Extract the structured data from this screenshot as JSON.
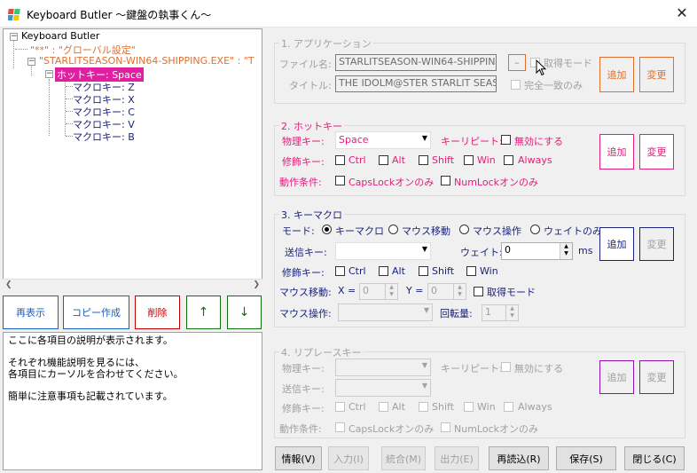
{
  "window": {
    "title": "Keyboard Butler 〜鍵盤の執事くん〜",
    "close": "✕"
  },
  "tree": {
    "root": "Keyboard Butler",
    "global": "\"**\" : \"グローバル設定\"",
    "app": "\"STARLITSEASON-WIN64-SHIPPING.EXE\" : \"T",
    "hotkey": "ホットキー: Space",
    "macros": [
      "マクロキー: Z",
      "マクロキー: X",
      "マクロキー: C",
      "マクロキー: V",
      "マクロキー: B"
    ]
  },
  "tree_buttons": {
    "refresh": "再表示",
    "copy": "コピー作成",
    "delete": "削除",
    "up": "↑",
    "down": "↓"
  },
  "description": {
    "line1": "ここに各項目の説明が表示されます。",
    "line2": "それぞれ機能説明を見るには、",
    "line3": "各項目にカーソルを合わせてください。",
    "line4": "簡単に注意事項も記載されています。"
  },
  "app": {
    "title": "1. アプリケーション",
    "file_label": "ファイル名:",
    "file_value": "STARLITSEASON-WIN64-SHIPPIN",
    "title_label": "タイトル:",
    "title_value": "THE IDOLM@STER STARLIT SEAS",
    "dash": "–",
    "capture": "取得モード",
    "exact": "完全一致のみ",
    "add": "追加",
    "change": "変更"
  },
  "hotkey": {
    "title": "2. ホットキー",
    "phys_label": "物理キー:",
    "phys_value": "Space",
    "repeat_label": "キーリピート:",
    "repeat_disable": "無効にする",
    "mod_label": "修飾キー:",
    "ctrl": "Ctrl",
    "alt": "Alt",
    "shift": "Shift",
    "win": "Win",
    "always": "Always",
    "cond_label": "動作条件:",
    "capslock": "CapsLockオンのみ",
    "numlock": "NumLockオンのみ",
    "add": "追加",
    "change": "変更"
  },
  "macro": {
    "title": "3. キーマクロ",
    "mode_label": "モード:",
    "mode_key": "キーマクロ",
    "mode_move": "マウス移動",
    "mode_op": "マウス操作",
    "mode_wait": "ウェイトのみ",
    "send_label": "送信キー:",
    "wait_label": "ウェイト:",
    "wait_value": "0",
    "ms": "ms",
    "mod_label": "修飾キー:",
    "ctrl": "Ctrl",
    "alt": "Alt",
    "shift": "Shift",
    "win": "Win",
    "move_label": "マウス移動:",
    "x_label": "X =",
    "x_value": "0",
    "y_label": "Y =",
    "y_value": "0",
    "capture": "取得モード",
    "op_label": "マウス操作:",
    "rot_label": "回転量:",
    "rot_value": "1",
    "add": "追加",
    "change": "変更"
  },
  "replace": {
    "title": "4. リプレースキー",
    "phys_label": "物理キー:",
    "repeat_label": "キーリピート:",
    "repeat_disable": "無効にする",
    "send_label": "送信キー:",
    "mod_label": "修飾キー:",
    "ctrl": "Ctrl",
    "alt": "Alt",
    "shift": "Shift",
    "win": "Win",
    "always": "Always",
    "cond_label": "動作条件:",
    "capslock": "CapsLockオンのみ",
    "numlock": "NumLockオンのみ",
    "add": "追加",
    "change": "変更"
  },
  "bottom": {
    "info": "情報(V)",
    "input": "入力(I)",
    "merge": "統合(M)",
    "output": "出力(E)",
    "reload": "再読込(R)",
    "save": "保存(S)",
    "close": "閉じる(C)"
  },
  "colors": {
    "orange": "#e07030",
    "pink": "#e0207a",
    "navy": "#1a237e",
    "green": "#107010",
    "red": "#c00000",
    "blue": "#1a5fc0",
    "purple": "#9010b0",
    "selected": "#e020a0"
  }
}
